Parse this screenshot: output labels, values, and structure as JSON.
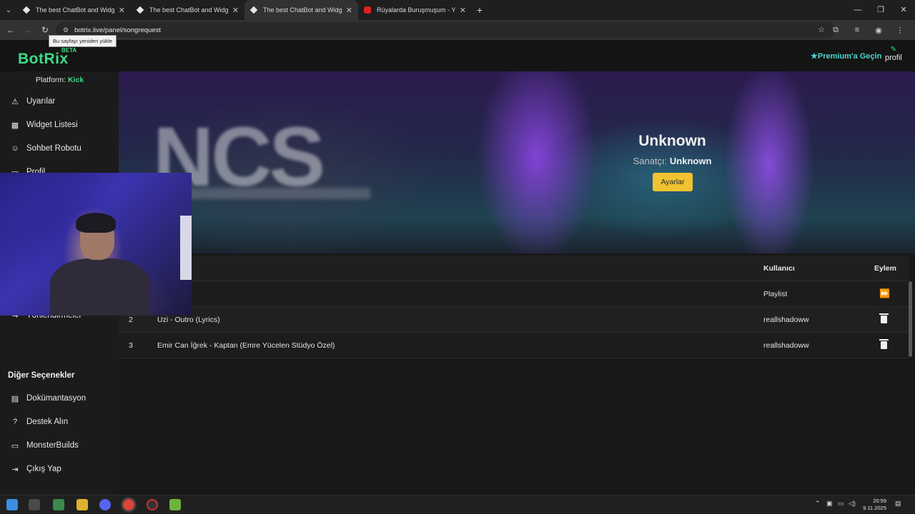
{
  "browser": {
    "tabs": [
      {
        "title": "The best ChatBot and Widgets",
        "active": false,
        "favicon": "diamond-icon"
      },
      {
        "title": "The best ChatBot and Widgets",
        "active": false,
        "favicon": "diamond-icon"
      },
      {
        "title": "The best ChatBot and Widgets",
        "active": true,
        "favicon": "diamond-icon"
      },
      {
        "title": "Rüyalarda Buruşmuşum - YouTube",
        "active": false,
        "favicon": "youtube-icon"
      }
    ],
    "url": "botrix.live/panel/songrequest",
    "reload_tooltip": "Bu sayfayı yeniden yükle"
  },
  "header": {
    "logo": "BotRix",
    "beta": "BETA",
    "premium_label": "Premium'a Geçin",
    "profile_label": "profil"
  },
  "sidebar": {
    "platform_label": "Platform:",
    "platform_value": "Kick",
    "items": [
      {
        "label": "Uyarılar",
        "icon": "warning-icon"
      },
      {
        "label": "Widget Listesi",
        "icon": "grid-icon"
      },
      {
        "label": "Sohbet Robotu",
        "icon": "robot-icon"
      },
      {
        "label": "Profil",
        "icon": "id-card-icon"
      },
      {
        "label": "Yönlendirmeler",
        "icon": "redirect-icon"
      }
    ],
    "section_title": "Diğer Seçenekler",
    "other_items": [
      {
        "label": "Dokümantasyon",
        "icon": "scroll-icon"
      },
      {
        "label": "Destek Alın",
        "icon": "question-icon"
      },
      {
        "label": "MonsterBuilds",
        "icon": "laptop-icon"
      },
      {
        "label": "Çıkış Yap",
        "icon": "logout-icon"
      }
    ]
  },
  "now_playing": {
    "title": "Unknown",
    "artist_label": "Sanatçı:",
    "artist_value": "Unknown",
    "settings_button": "Ayarlar"
  },
  "queue": {
    "headers": {
      "user": "Kullanıcı",
      "action": "Eylem"
    },
    "rows": [
      {
        "index": "",
        "song": "",
        "user": "Playlist",
        "action": "skip-icon"
      },
      {
        "index": "2",
        "song": "Uzi - Outro (Lyrics)",
        "user": "reallshadoww",
        "action": "trash-icon"
      },
      {
        "index": "3",
        "song": "Emir Can İğrek - Kaptan (Emre Yücelen Stüdyo Özel)",
        "user": "reallshadoww",
        "action": "trash-icon"
      }
    ]
  },
  "taskbar": {
    "time": "20:59",
    "date": "9.11.2025"
  },
  "colors": {
    "accent_green": "#3ddc84",
    "premium_cyan": "#47d7d0",
    "settings_yellow": "#f1c232"
  }
}
